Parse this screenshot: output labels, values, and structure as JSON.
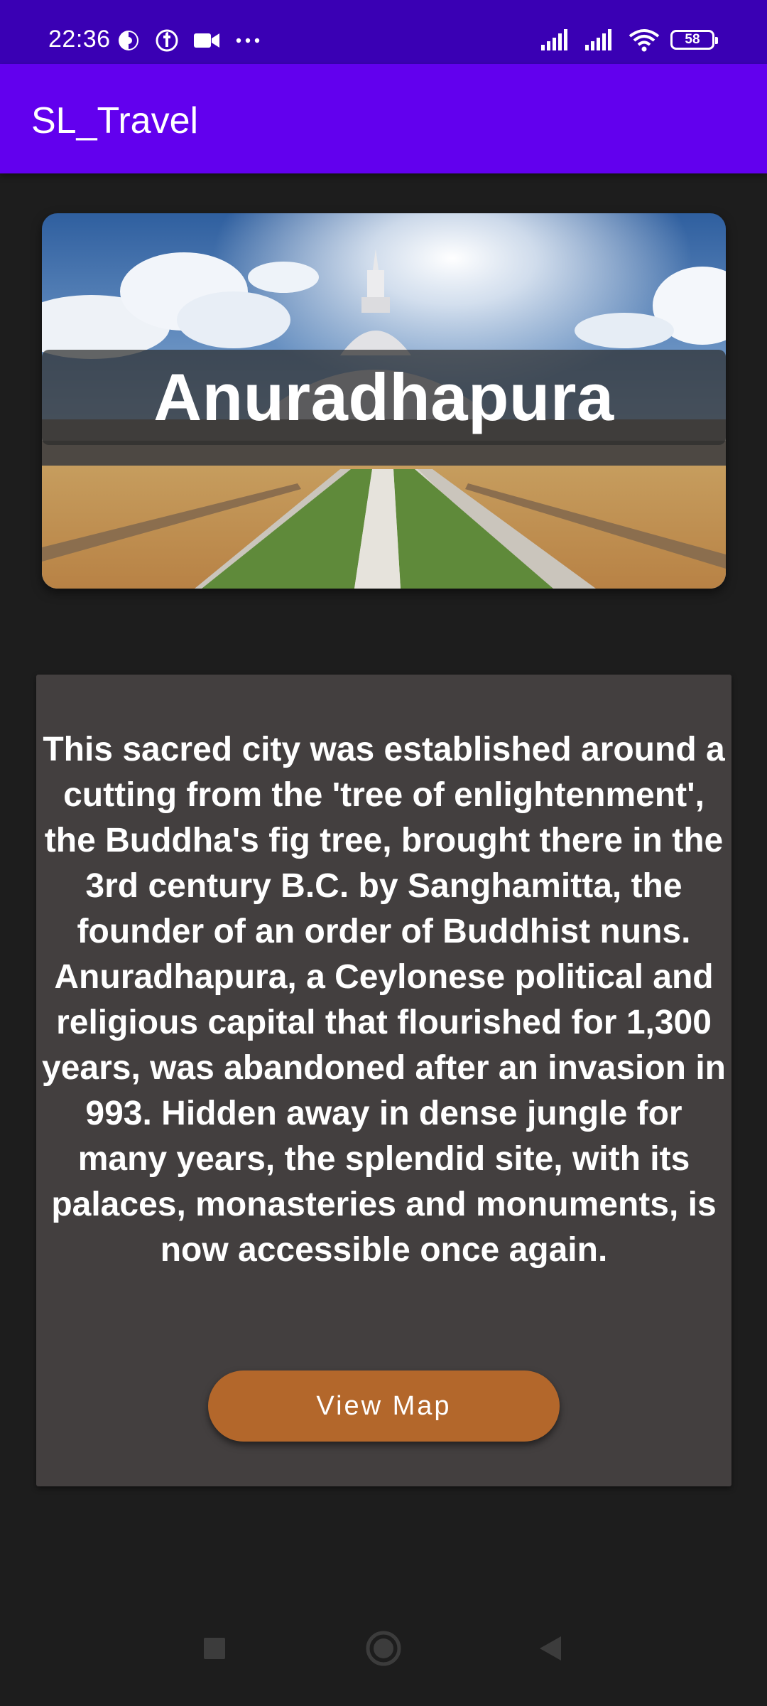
{
  "status_bar": {
    "time": "22:36",
    "battery_level": "58",
    "icons": [
      "data-saver-icon",
      "facebook-icon",
      "video-camera-icon",
      "more-dots-icon",
      "signal-icon",
      "signal-icon",
      "wifi-icon",
      "battery-icon"
    ]
  },
  "app_bar": {
    "title": "SL_Travel"
  },
  "hero": {
    "title": "Anuradhapura"
  },
  "description": {
    "text": "This sacred city was established around a cutting from the 'tree of enlightenment', the Buddha's fig tree, brought there in the 3rd century B.C. by Sanghamitta, the founder of an order of Buddhist nuns. Anuradhapura, a Ceylonese political and religious capital that flourished for 1,300 years, was abandoned after an invasion in 993. Hidden away in dense jungle for many years, the splendid site, with its palaces, monasteries and monuments, is now accessible once again."
  },
  "actions": {
    "view_map_label": "View Map"
  },
  "colors": {
    "status_bar": "#3a00b4",
    "app_bar": "#6200ee",
    "background": "#1d1d1d",
    "card": "#433f3f",
    "button": "#b3672b"
  },
  "nav_bar": {
    "icons": [
      "recents-square-icon",
      "home-circle-icon",
      "back-triangle-icon"
    ]
  }
}
